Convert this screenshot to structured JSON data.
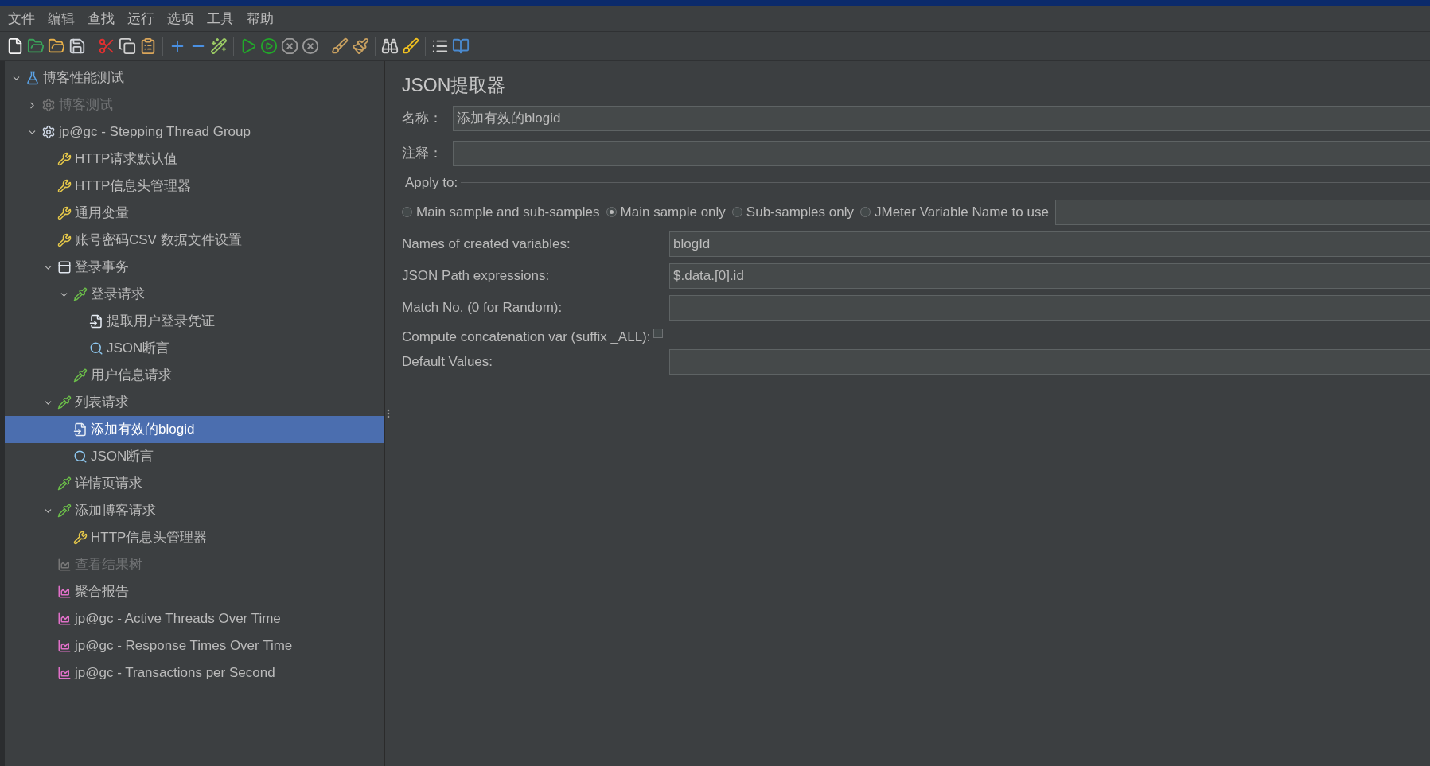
{
  "menu": [
    "文件",
    "编辑",
    "查找",
    "运行",
    "选项",
    "工具",
    "帮助"
  ],
  "tree": [
    {
      "label": "博客性能测试",
      "kind": "testplan",
      "expanded": true,
      "disabled": false,
      "selected": false,
      "children": [
        {
          "label": "博客测试",
          "kind": "threadgroup",
          "expanded": false,
          "disabled": true,
          "selected": false
        },
        {
          "label": "jp@gc - Stepping Thread Group",
          "kind": "threadgroup",
          "expanded": true,
          "disabled": false,
          "selected": false,
          "children": [
            {
              "label": "HTTP请求默认值",
              "kind": "config",
              "disabled": false,
              "selected": false
            },
            {
              "label": "HTTP信息头管理器",
              "kind": "config",
              "disabled": false,
              "selected": false
            },
            {
              "label": "通用变量",
              "kind": "config",
              "disabled": false,
              "selected": false
            },
            {
              "label": "账号密码CSV 数据文件设置",
              "kind": "config",
              "disabled": false,
              "selected": false
            },
            {
              "label": "登录事务",
              "kind": "transaction",
              "expanded": true,
              "disabled": false,
              "selected": false,
              "children": [
                {
                  "label": "登录请求",
                  "kind": "sampler",
                  "expanded": true,
                  "disabled": false,
                  "selected": false,
                  "children": [
                    {
                      "label": "提取用户登录凭证",
                      "kind": "extractor",
                      "disabled": false,
                      "selected": false
                    },
                    {
                      "label": "JSON断言",
                      "kind": "assertion",
                      "disabled": false,
                      "selected": false
                    }
                  ]
                },
                {
                  "label": "用户信息请求",
                  "kind": "sampler",
                  "disabled": false,
                  "selected": false
                }
              ]
            },
            {
              "label": "列表请求",
              "kind": "sampler",
              "expanded": true,
              "disabled": false,
              "selected": false,
              "children": [
                {
                  "label": "添加有效的blogid",
                  "kind": "extractor",
                  "disabled": false,
                  "selected": true
                },
                {
                  "label": "JSON断言",
                  "kind": "assertion",
                  "disabled": false,
                  "selected": false
                }
              ]
            },
            {
              "label": "详情页请求",
              "kind": "sampler",
              "disabled": false,
              "selected": false
            },
            {
              "label": "添加博客请求",
              "kind": "sampler",
              "expanded": true,
              "disabled": false,
              "selected": false,
              "children": [
                {
                  "label": "HTTP信息头管理器",
                  "kind": "config",
                  "disabled": false,
                  "selected": false
                }
              ]
            },
            {
              "label": "查看结果树",
              "kind": "listener",
              "disabled": true,
              "selected": false
            },
            {
              "label": "聚合报告",
              "kind": "listener",
              "disabled": false,
              "selected": false
            },
            {
              "label": "jp@gc - Active Threads Over Time",
              "kind": "listener",
              "disabled": false,
              "selected": false
            },
            {
              "label": "jp@gc - Response Times Over Time",
              "kind": "listener",
              "disabled": false,
              "selected": false
            },
            {
              "label": "jp@gc - Transactions per Second",
              "kind": "listener",
              "disabled": false,
              "selected": false
            }
          ]
        }
      ]
    }
  ],
  "panel": {
    "title": "JSON提取器",
    "name": {
      "label": "名称：",
      "value": "添加有效的blogid"
    },
    "comment": {
      "label": "注释："
    },
    "apply_to": {
      "label": "Apply to:",
      "options": [
        {
          "label": "Main sample and sub-samples",
          "selected": false
        },
        {
          "label": "Main sample only",
          "selected": true
        },
        {
          "label": "Sub-samples only",
          "selected": false
        },
        {
          "label": "JMeter Variable Name to use",
          "selected": false
        }
      ]
    },
    "fields": [
      {
        "kind": "text",
        "label": "Names of created variables:",
        "value": "blogId"
      },
      {
        "kind": "text",
        "label": "JSON Path expressions:",
        "value": "$.data.[0].id"
      },
      {
        "kind": "text",
        "label": "Match No. (0 for Random):"
      },
      {
        "kind": "checkbox",
        "label": "Compute concatenation var (suffix _ALL):",
        "checked": false
      },
      {
        "kind": "text",
        "label": "Default Values:"
      }
    ]
  }
}
